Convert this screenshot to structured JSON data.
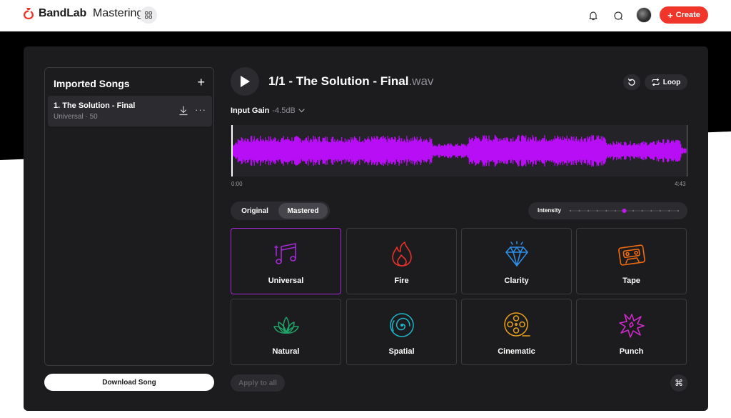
{
  "header": {
    "brand": "BandLab",
    "product": "Mastering",
    "create_label": "Create",
    "icons": [
      "bandlab-logo-icon",
      "apps-grid-icon",
      "bell-icon",
      "chat-icon",
      "avatar",
      "plus-icon"
    ]
  },
  "songs": {
    "title": "Imported Songs",
    "items": [
      {
        "name": "1. The Solution - Final",
        "meta": "Universal · 50"
      }
    ],
    "download_label": "Download Song"
  },
  "player": {
    "title": "1/1 - The Solution - Final",
    "extension": ".wav",
    "loop_label": "Loop",
    "input_gain_label": "Input Gain",
    "input_gain_value": "-4.5dB",
    "time_start": "0:00",
    "time_end": "4:43",
    "progress": 0.0
  },
  "toggle": {
    "original": "Original",
    "mastered": "Mastered",
    "selected": "Mastered"
  },
  "intensity": {
    "label": "Intensity",
    "steps": 13,
    "value_step": 6
  },
  "presets": [
    {
      "label": "Universal",
      "icon": "music-notes-icon",
      "color": "#a42ad6",
      "selected": true
    },
    {
      "label": "Fire",
      "icon": "flame-icon",
      "color": "#e8322c",
      "selected": false
    },
    {
      "label": "Clarity",
      "icon": "diamond-icon",
      "color": "#2f8fe8",
      "selected": false
    },
    {
      "label": "Tape",
      "icon": "cassette-icon",
      "color": "#f06a12",
      "selected": false
    },
    {
      "label": "Natural",
      "icon": "lotus-icon",
      "color": "#1fa36a",
      "selected": false
    },
    {
      "label": "Spatial",
      "icon": "spiral-galaxy-icon",
      "color": "#1fb5c8",
      "selected": false
    },
    {
      "label": "Cinematic",
      "icon": "film-reel-icon",
      "color": "#e8a11a",
      "selected": false
    },
    {
      "label": "Punch",
      "icon": "burst-icon",
      "color": "#d42ad0",
      "selected": false
    }
  ],
  "actions": {
    "apply_all_label": "Apply to all",
    "shortcut_glyph": "⌘"
  },
  "colors": {
    "accent": "#f0362b",
    "waveform": "#b80ef5",
    "panel": "#1c1c1e"
  }
}
